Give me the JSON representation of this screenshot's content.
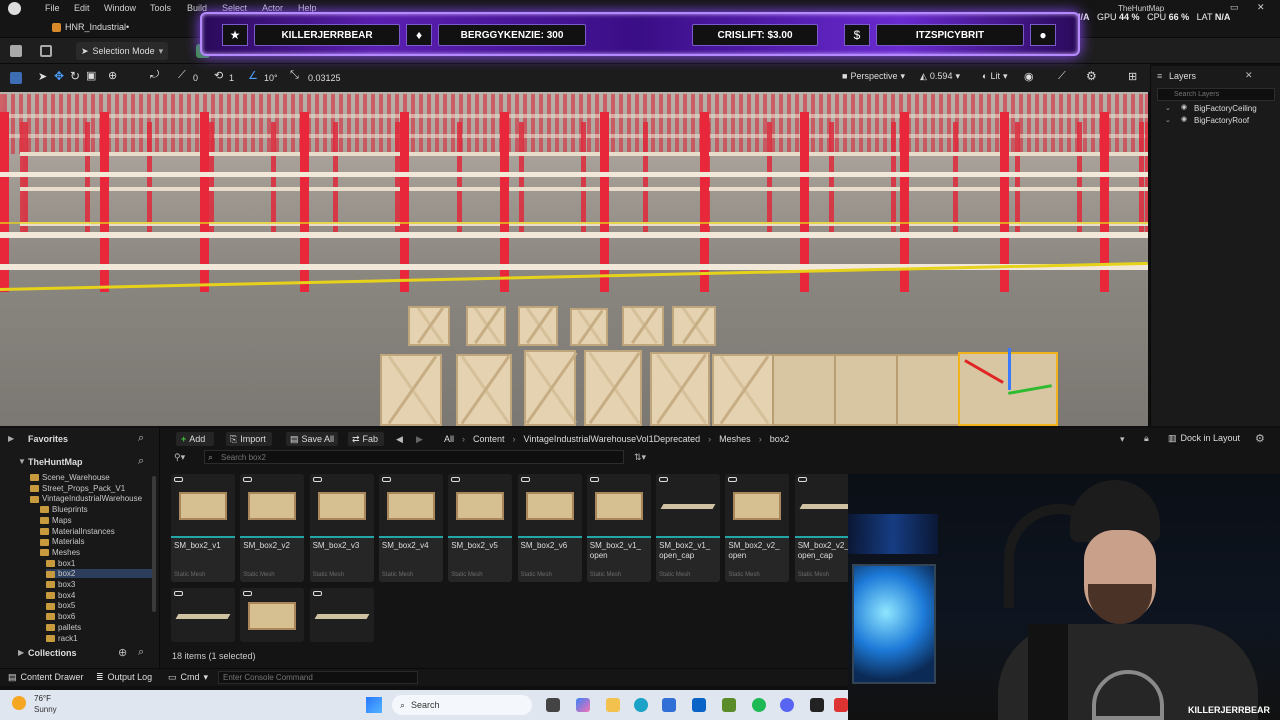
{
  "menubar": {
    "items": [
      "File",
      "Edit",
      "Window",
      "Tools",
      "Build",
      "Select",
      "Actor",
      "Help"
    ],
    "map_name": "TheHuntMap",
    "stats": {
      "gpu_label": "GPU",
      "gpu_value": "44 %",
      "cpu_label": "CPU",
      "cpu_value": "66 %",
      "lat_label": "LAT",
      "lat_value": "N/A",
      "left_value": "N/A"
    }
  },
  "tabrow": {
    "tab_label": "HNR_Industrial•"
  },
  "toolbar": {
    "mode_label": "Selection Mode"
  },
  "viewport_toolbar": {
    "rotation_snap": "10°",
    "scale_snap": "0.03125",
    "num_a": "0",
    "num_b": "1",
    "perspective_label": "Perspective",
    "fov_value": "0.594",
    "lit_label": "Lit"
  },
  "stream_banner": {
    "pill1": "KILLERJERRBEAR",
    "pill2": "BERGGYKENZIE: 300",
    "pill3": "CRISLIFT: $3.00",
    "pill4": "ITZSPICYBRIT",
    "icons": [
      "star-icon",
      "flame-icon",
      "dollar-icon",
      "user-icon"
    ],
    "icon_glyphs": [
      "★",
      "♦",
      "$",
      "●"
    ]
  },
  "layers": {
    "title": "Layers",
    "search_placeholder": "Search Layers",
    "items": [
      "BigFactoryCeiling",
      "BigFactoryRoof"
    ]
  },
  "content_browser": {
    "favorites_label": "Favorites",
    "map_label": "TheHuntMap",
    "tree": [
      "Scene_Warehouse",
      "Street_Props_Pack_V1",
      "VintageIndustrialWarehouse",
      "Blueprints",
      "Maps",
      "MaterialInstances",
      "Materials",
      "Meshes",
      "box1",
      "box2",
      "box3",
      "box4",
      "box5",
      "box6",
      "pallets",
      "rack1"
    ],
    "collections_label": "Collections",
    "add_label": "Add",
    "import_label": "Import",
    "save_all_label": "Save All",
    "fab_label": "Fab",
    "breadcrumbs": [
      "All",
      "Content",
      "VintageIndustrialWarehouseVol1Deprecated",
      "Meshes",
      "box2"
    ],
    "dock_label": "Dock in Layout",
    "search_placeholder": "Search box2",
    "items_count": "18 items (1 selected)",
    "asset_type": "Static Mesh",
    "assets": [
      {
        "name": "SM_box2_v1",
        "kind": "crate"
      },
      {
        "name": "SM_box2_v2",
        "kind": "crate"
      },
      {
        "name": "SM_box2_v3",
        "kind": "crate"
      },
      {
        "name": "SM_box2_v4",
        "kind": "crate"
      },
      {
        "name": "SM_box2_v5",
        "kind": "crate"
      },
      {
        "name": "SM_box2_v6",
        "kind": "crate"
      },
      {
        "name": "SM_box2_v1_ open",
        "kind": "crate"
      },
      {
        "name": "SM_box2_v1_ open_cap",
        "kind": "flat"
      },
      {
        "name": "SM_box2_v2_ open",
        "kind": "crate"
      },
      {
        "name": "SM_box2_v2_ open_cap",
        "kind": "flat"
      }
    ],
    "assets_row2": [
      "flat",
      "crate",
      "flat"
    ]
  },
  "statusbar": {
    "content_drawer": "Content Drawer",
    "output_log": "Output Log",
    "cmd_label": "Cmd",
    "console_placeholder": "Enter Console Command"
  },
  "taskbar": {
    "temp": "76°F",
    "weather": "Sunny",
    "search_label": "Search"
  },
  "webcam": {
    "username": "KILLERJERRBEAR"
  }
}
